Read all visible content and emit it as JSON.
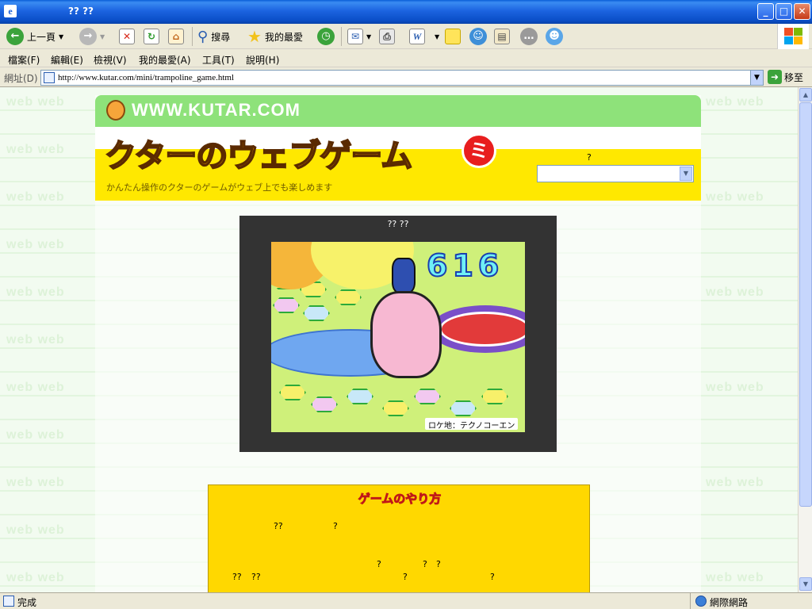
{
  "window": {
    "title": "?? ??",
    "minimize": "_",
    "maximize": "□",
    "close": "✕"
  },
  "toolbar": {
    "back_label": "上一頁",
    "search_label": "搜尋",
    "favorites_label": "我的最愛",
    "word_label": "W"
  },
  "menu": {
    "items": [
      "檔案(F)",
      "編輯(E)",
      "檢視(V)",
      "我的最愛(A)",
      "工具(T)",
      "說明(H)"
    ]
  },
  "address": {
    "label": "網址(D)",
    "url": "http://www.kutar.com/mini/trampoline_game.html",
    "go_label": "移至"
  },
  "site": {
    "header_url": "WWW.KUTAR.COM",
    "logo": "クターのウェブゲーム",
    "badge": "ミ",
    "tagline": "かんたん操作のクターのゲームがウェブ上でも楽しめます",
    "select_label": "?",
    "background_word": "web web"
  },
  "game": {
    "title": "?? ??",
    "score": "616",
    "location": "ロケ地：テクノコーエン"
  },
  "howto": {
    "title": "ゲームのやり方",
    "line1a": "??",
    "line1b": "?",
    "line2a": "?",
    "line2b": "?",
    "line2c": "?",
    "line3a": "??",
    "line3b": "??",
    "line3c": "?",
    "line3d": "?"
  },
  "status": {
    "text": "完成",
    "zone": "網際網路"
  }
}
